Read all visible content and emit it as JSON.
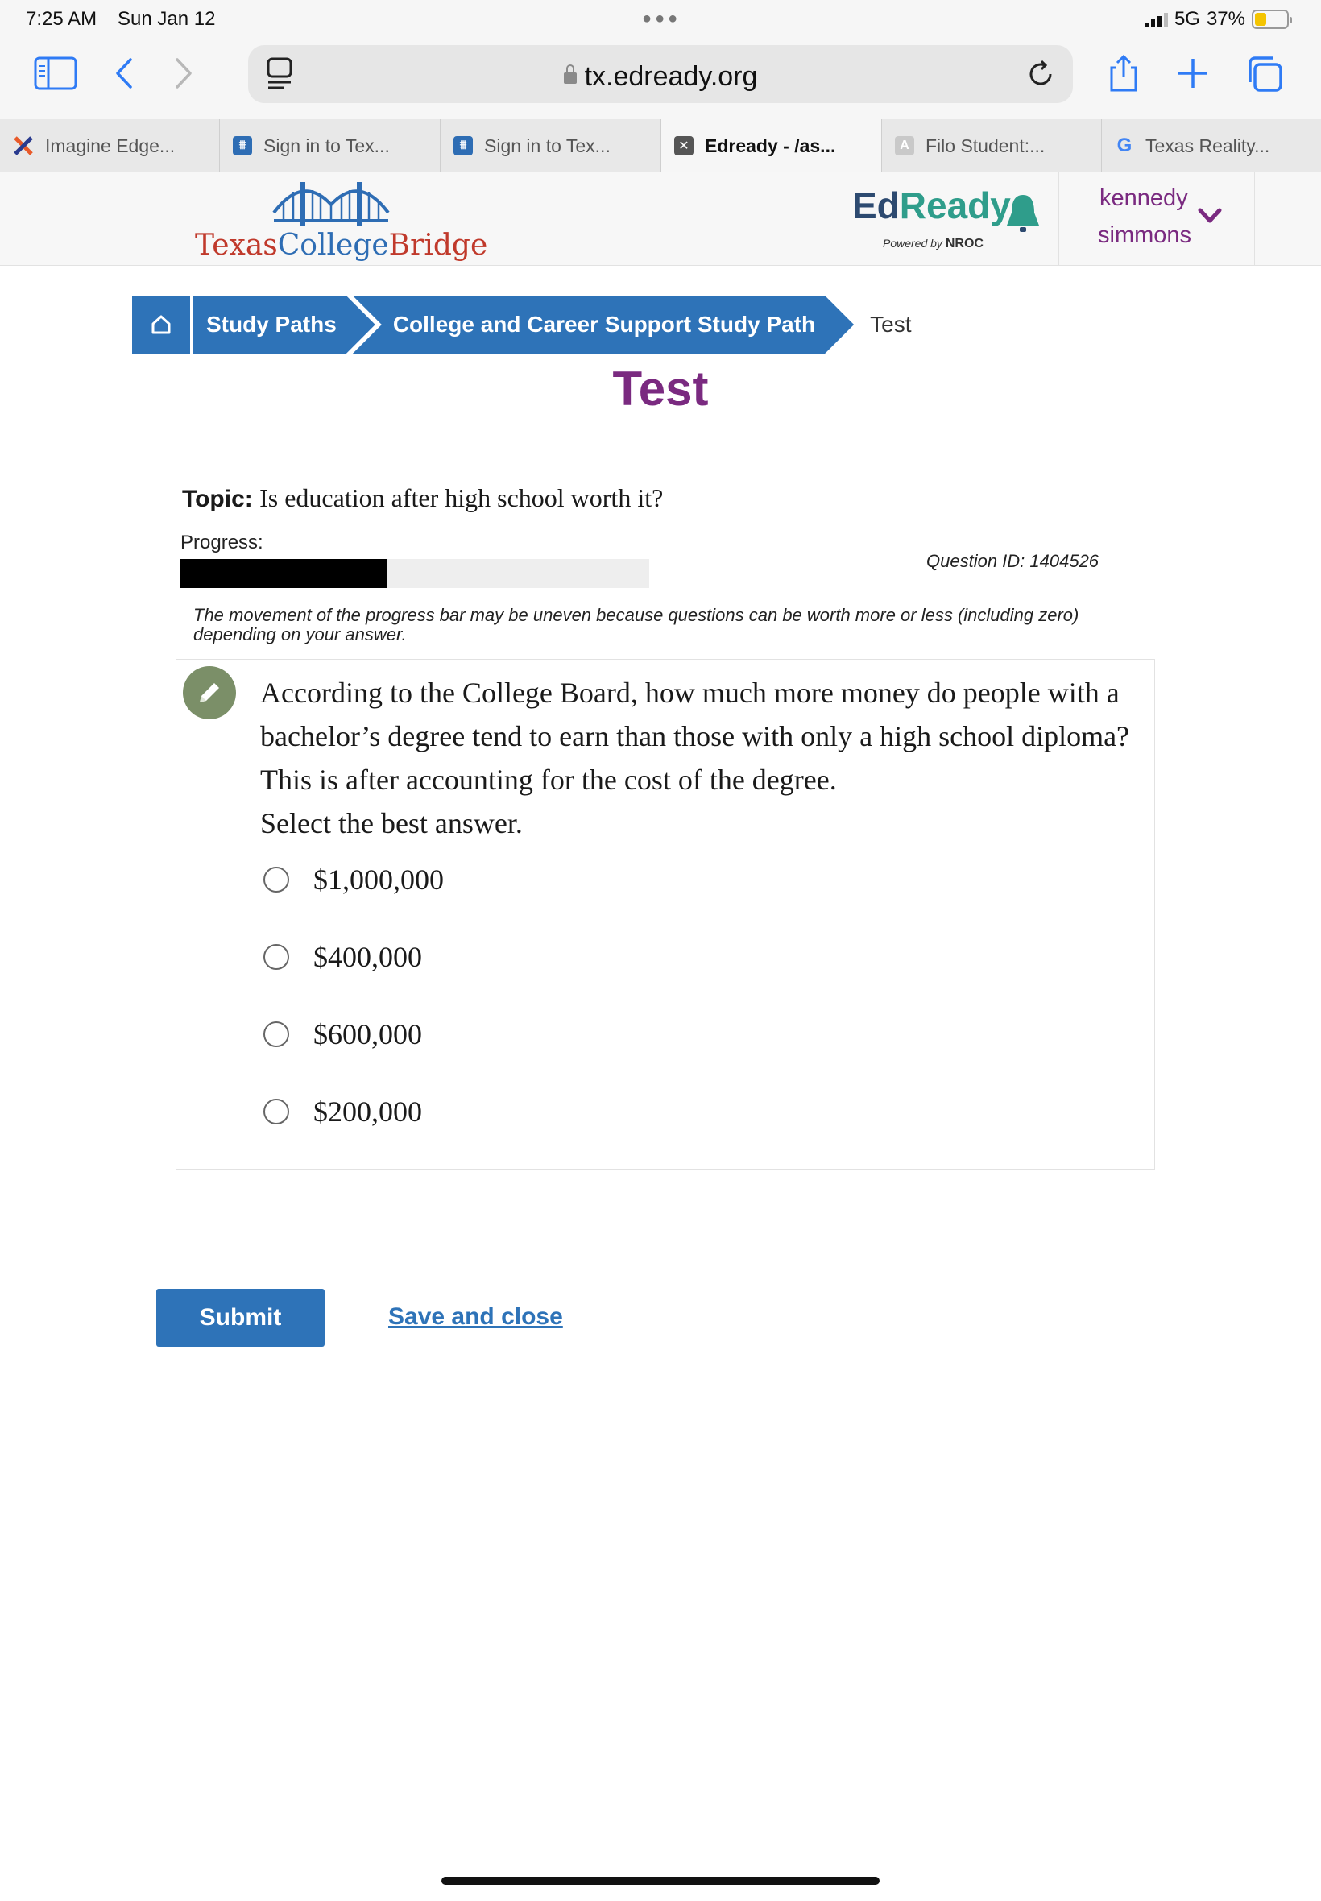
{
  "status_bar": {
    "time": "7:25 AM",
    "date": "Sun Jan 12",
    "network": "5G",
    "battery_percent": "37%",
    "battery_level": 0.37,
    "battery_color": "#f4c400"
  },
  "browser": {
    "url": "tx.edready.org",
    "accent_color": "#2f7bf5",
    "tabs": [
      {
        "label": "Imagine Edge...",
        "icon": "imagine-edge-icon",
        "active": false
      },
      {
        "label": "Sign in to Tex...",
        "icon": "bridge-icon",
        "active": false
      },
      {
        "label": "Sign in to Tex...",
        "icon": "bridge-icon",
        "active": false
      },
      {
        "label": "Edready - /as...",
        "icon": "close-tab-icon",
        "active": true
      },
      {
        "label": "Filo Student:...",
        "icon": "filo-icon",
        "active": false
      },
      {
        "label": "Texas Reality...",
        "icon": "google-icon",
        "active": false
      }
    ]
  },
  "header": {
    "logo_part1": "Texas",
    "logo_part2": "College",
    "logo_part3": "Bridge",
    "edready_part1": "Ed",
    "edready_part2": "Ready",
    "powered_by_prefix": "Powered by",
    "powered_by_brand": "NROC",
    "user_first": "kennedy",
    "user_last": "simmons"
  },
  "breadcrumb": {
    "items": [
      "Study Paths",
      "College and Career Support Study Path"
    ],
    "current": "Test"
  },
  "page": {
    "title": "Test",
    "title_color": "#7a2a80",
    "topic_label": "Topic:",
    "topic": "Is education after high school worth it?",
    "progress_label": "Progress:",
    "progress_fraction": 0.44,
    "question_id": "Question ID: 1404526",
    "note": "The movement of the progress bar may be uneven because questions can be worth more or less (including zero) depending on your answer."
  },
  "question": {
    "text": "According to the College Board, how much more money do people with a bachelor’s degree tend to earn than those with only a high school diploma? This is after accounting for the cost of the degree.",
    "instruction": "Select the best answer.",
    "options": [
      "$1,000,000",
      "$400,000",
      "$600,000",
      "$200,000"
    ]
  },
  "actions": {
    "submit": "Submit",
    "save_close": "Save and close",
    "primary_color": "#2e73b8"
  }
}
